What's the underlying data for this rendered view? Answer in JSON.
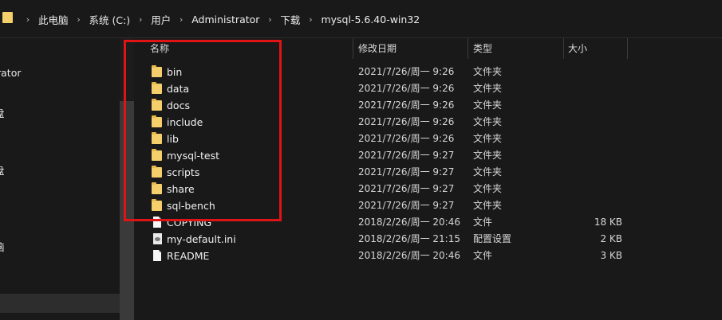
{
  "breadcrumb": [
    "此电脑",
    "系统 (C:)",
    "用户",
    "Administrator",
    "下载",
    "mysql-5.6.40-win32"
  ],
  "breadcrumb_separator": "›",
  "nav": {
    "partial_items": [
      "rator",
      "盘",
      "盘",
      "脑"
    ]
  },
  "columns": {
    "name": "名称",
    "date": "修改日期",
    "type": "类型",
    "size": "大小"
  },
  "files": [
    {
      "name": "bin",
      "date": "2021/7/26/周一 9:26",
      "type": "文件夹",
      "size": "",
      "icon": "folder-icon"
    },
    {
      "name": "data",
      "date": "2021/7/26/周一 9:26",
      "type": "文件夹",
      "size": "",
      "icon": "folder-icon"
    },
    {
      "name": "docs",
      "date": "2021/7/26/周一 9:26",
      "type": "文件夹",
      "size": "",
      "icon": "folder-icon"
    },
    {
      "name": "include",
      "date": "2021/7/26/周一 9:26",
      "type": "文件夹",
      "size": "",
      "icon": "folder-icon"
    },
    {
      "name": "lib",
      "date": "2021/7/26/周一 9:26",
      "type": "文件夹",
      "size": "",
      "icon": "folder-icon"
    },
    {
      "name": "mysql-test",
      "date": "2021/7/26/周一 9:27",
      "type": "文件夹",
      "size": "",
      "icon": "folder-icon"
    },
    {
      "name": "scripts",
      "date": "2021/7/26/周一 9:27",
      "type": "文件夹",
      "size": "",
      "icon": "folder-icon"
    },
    {
      "name": "share",
      "date": "2021/7/26/周一 9:27",
      "type": "文件夹",
      "size": "",
      "icon": "folder-icon"
    },
    {
      "name": "sql-bench",
      "date": "2021/7/26/周一 9:27",
      "type": "文件夹",
      "size": "",
      "icon": "folder-icon"
    },
    {
      "name": "COPYING",
      "date": "2018/2/26/周一 20:46",
      "type": "文件",
      "size": "18 KB",
      "icon": "file-icon"
    },
    {
      "name": "my-default.ini",
      "date": "2018/2/26/周一 21:15",
      "type": "配置设置",
      "size": "2 KB",
      "icon": "settings-file-icon"
    },
    {
      "name": "README",
      "date": "2018/2/26/周一 20:46",
      "type": "文件",
      "size": "3 KB",
      "icon": "file-icon"
    }
  ],
  "colors": {
    "background": "#191919",
    "highlight_box": "#e01414",
    "folder": "#f4cf6b"
  }
}
